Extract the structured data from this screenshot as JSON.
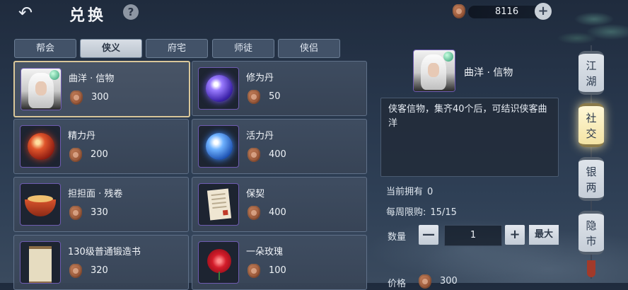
{
  "header": {
    "back_icon": "back-arrow-icon",
    "title": "兑换",
    "help": "?",
    "currency_amount": "8116",
    "add": "+"
  },
  "tabs": [
    {
      "label": "帮会",
      "active": false
    },
    {
      "label": "侠义",
      "active": true
    },
    {
      "label": "府宅",
      "active": false
    },
    {
      "label": "师徒",
      "active": false
    },
    {
      "label": "侠侣",
      "active": false
    }
  ],
  "items": [
    {
      "name": "曲洋 · 信物",
      "price": "300",
      "thumb": "portrait",
      "selected": true
    },
    {
      "name": "修为丹",
      "price": "50",
      "thumb": "purple-orb"
    },
    {
      "name": "精力丹",
      "price": "200",
      "thumb": "red-orb"
    },
    {
      "name": "活力丹",
      "price": "400",
      "thumb": "blue-orb"
    },
    {
      "name": "担担面 · 残卷",
      "price": "330",
      "thumb": "noodle-bowl"
    },
    {
      "name": "保契",
      "price": "400",
      "thumb": "contract-paper"
    },
    {
      "name": "130级普通锻造书",
      "price": "320",
      "thumb": "scroll"
    },
    {
      "name": "一朵玫瑰",
      "price": "100",
      "thumb": "rose"
    }
  ],
  "detail": {
    "name": "曲洋 · 信物",
    "description": "侠客信物，集齐40个后，可结识侠客曲洋",
    "owned_label": "当前拥有",
    "owned_value": "0",
    "limit_label": "每周限购:",
    "limit_value": "15/15",
    "qty_label": "数量",
    "qty_minus": "—",
    "qty_value": "1",
    "qty_plus": "+",
    "max_label": "最大",
    "price_label": "价格",
    "price_value": "300"
  },
  "side_menu": [
    {
      "label": "江湖",
      "active": false
    },
    {
      "label": "社交",
      "active": true
    },
    {
      "label": "银两",
      "active": false
    },
    {
      "label": "隐市",
      "active": false
    }
  ],
  "colors": {
    "accent": "#d9c79a",
    "tab_active": "#c9d0d8",
    "panel": "#3f4d60"
  }
}
